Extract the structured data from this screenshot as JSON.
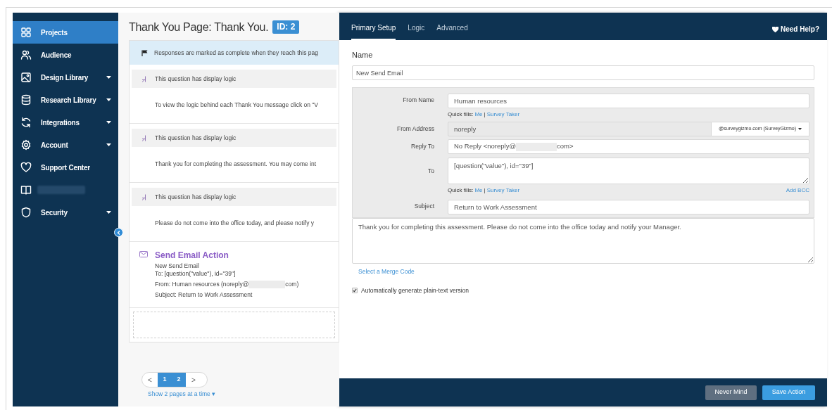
{
  "sidebar": {
    "items": [
      {
        "kind": "grid",
        "label": "Projects",
        "caret": false,
        "selected": true
      },
      {
        "kind": "people",
        "label": "Audience",
        "caret": false,
        "selected": false
      },
      {
        "kind": "image",
        "label": "Design Library",
        "caret": true,
        "selected": false
      },
      {
        "kind": "database",
        "label": "Research Library",
        "caret": true,
        "selected": false
      },
      {
        "kind": "sync",
        "label": "Integrations",
        "caret": true,
        "selected": false
      },
      {
        "kind": "gear",
        "label": "Account",
        "caret": true,
        "selected": false
      },
      {
        "kind": "heart",
        "label": "Support Center",
        "caret": false,
        "selected": false
      },
      {
        "kind": "book",
        "redacted": true,
        "caret": false,
        "selected": false
      },
      {
        "kind": "shield",
        "label": "Security",
        "caret": true,
        "selected": false
      }
    ]
  },
  "page": {
    "title": "Thank You Page: Thank You.",
    "id_badge": "ID: 2",
    "banner": "Responses are marked as complete when they reach this pag",
    "logic_blocks": [
      {
        "header": "This question has display logic",
        "text": "To view the logic behind each Thank You message click on \"V"
      },
      {
        "header": "This question has display logic",
        "text": "Thank you for completing the assessment. You may come int"
      },
      {
        "header": "This question has display logic",
        "text": "Please do not come into the office today, and please notify y"
      }
    ],
    "action": {
      "title": "Send Email Action",
      "lines": [
        {
          "text": "New Send Email"
        },
        {
          "text": "To: [question(\"value\"), id=\"39\"]"
        },
        {
          "text": "From: Human resources (noreply@",
          "redacted_suffix": "com)"
        },
        {
          "text": "Subject: Return to Work Assessment"
        }
      ]
    },
    "pagination": {
      "prev": "<",
      "next": ">",
      "pages": [
        {
          "label": "1",
          "selected": true
        },
        {
          "label": "2",
          "selected": true
        }
      ],
      "per_page_link": "Show 2 pages at a time ▾"
    }
  },
  "panel": {
    "tabs": [
      {
        "label": "Primary Setup",
        "selected": true
      },
      {
        "label": "Logic",
        "selected": false
      },
      {
        "label": "Advanced",
        "selected": false
      }
    ],
    "help": "Need Help?",
    "name_label": "Name",
    "name_value": "New Send Email",
    "from_name": {
      "label": "From Name",
      "value": "Human resources"
    },
    "quick_fills_1": {
      "label": "Quick fills:",
      "links": [
        "Me",
        "Survey Taker"
      ],
      "separator": "|"
    },
    "from_address": {
      "label": "From Address",
      "value": "noreply",
      "domain": "@surveygizmo.com (SurveyGizmo)"
    },
    "reply_to": {
      "label": "Reply To",
      "value": "No Reply <noreply@",
      "redacted_suffix": "com>"
    },
    "to": {
      "label": "To",
      "value": "[question(\"value\"), id=\"39\"]"
    },
    "quick_fills_2": {
      "label": "Quick fills:",
      "links": [
        "Me",
        "Survey Taker"
      ],
      "separator": "|",
      "extra": "Add BCC"
    },
    "subject": {
      "label": "Subject",
      "value": "Return to Work Assessment"
    },
    "message": "Thank you for completing this assessment. Please do not come into the office today and notify your Manager.",
    "merge_code_link": "Select a Merge Code",
    "plain_text": {
      "label": "Automatically generate plain-text version",
      "checked": true
    },
    "buttons": [
      {
        "kind": "secondary",
        "label": "Never Mind"
      },
      {
        "kind": "primary",
        "label": "Save Action"
      }
    ]
  }
}
